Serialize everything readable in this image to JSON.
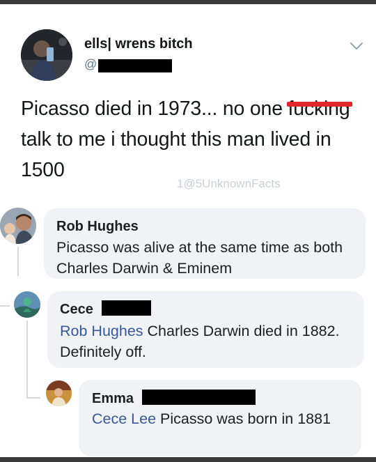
{
  "tweet": {
    "display_name": "ells| wrens bitch",
    "handle_prefix": "@",
    "text_part1": "Picasso died in 1973... no one ",
    "text_censored": "fucking",
    "text_part2": " talk to me i thought this man lived in 1500"
  },
  "watermark": "1@5UnknownFacts",
  "comments": [
    {
      "name": "Rob Hughes",
      "mention": "",
      "text": "Picasso was alive at the same time as both Charles Darwin & Eminem"
    },
    {
      "name": "Cece",
      "mention": "Rob Hughes",
      "text": " Charles Darwin died in 1882. Definitely off."
    },
    {
      "name": "Emma",
      "mention": "Cece Lee",
      "text": " Picasso was born in 1881"
    }
  ],
  "colors": {
    "mention": "#385898",
    "bubble": "#f0f2f5",
    "censor_bar": "#e3262b",
    "watermark": "#c9d1d8"
  },
  "icons": {
    "tweet_menu": "chevron-down-icon"
  }
}
